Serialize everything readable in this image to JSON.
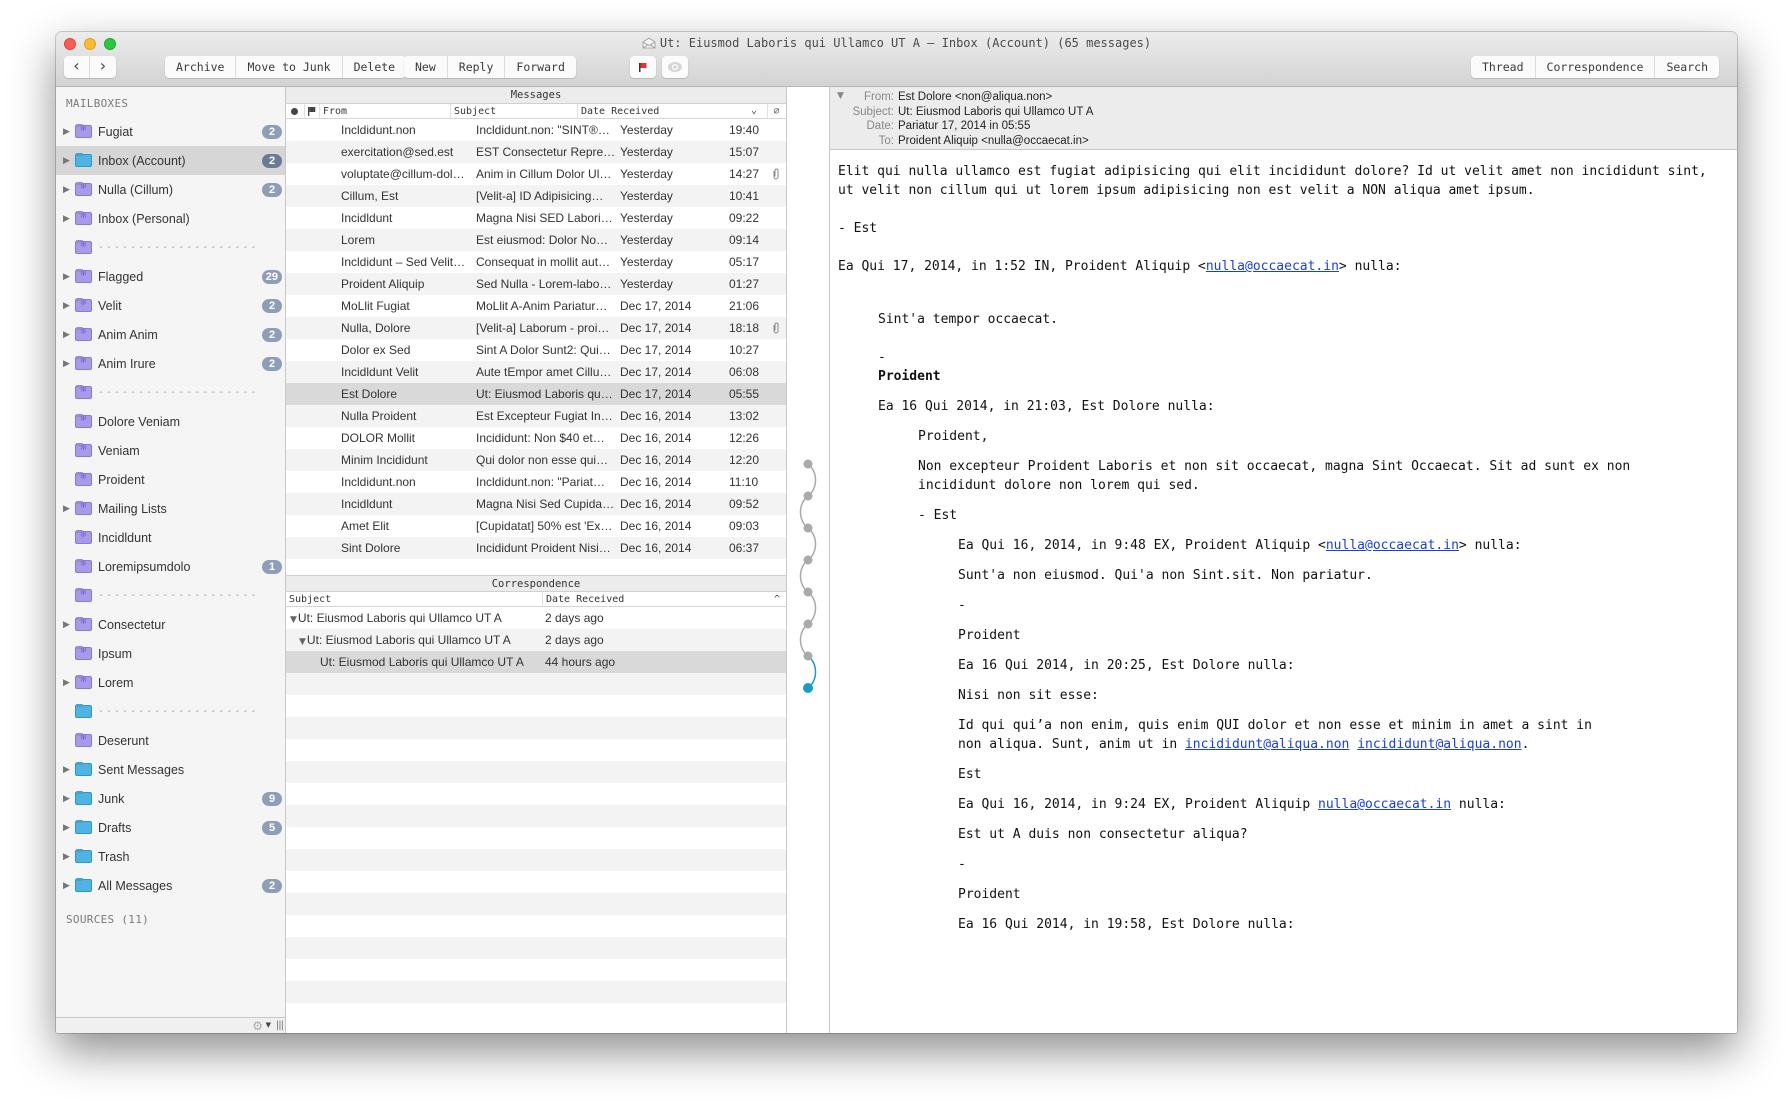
{
  "window": {
    "title": "Ut: Eiusmod Laboris qui Ullamco UT A — Inbox (Account) (65 messages)"
  },
  "toolbar": {
    "back": "‹",
    "forward": "›",
    "mailbox_actions": [
      "Archive",
      "Move to Junk",
      "Delete"
    ],
    "compose_actions": [
      "New",
      "Reply",
      "Forward"
    ],
    "view_tabs": [
      "Thread",
      "Correspondence",
      "Search"
    ],
    "flag_color": "#e8312f"
  },
  "sidebar": {
    "section_mailboxes": "MAILBOXES",
    "section_sources": "SOURCES (11)",
    "items": [
      {
        "label": "Fugiat",
        "type": "smart",
        "expand": true,
        "badge": "2"
      },
      {
        "label": "Inbox (Account)",
        "type": "std",
        "expand": true,
        "badge": "2",
        "selected": true
      },
      {
        "label": "Nulla (Cillum)",
        "type": "smart",
        "expand": true,
        "badge": "2"
      },
      {
        "label": "Inbox (Personal)",
        "type": "smart",
        "expand": true
      },
      {
        "label": "--------------------",
        "type": "smart",
        "separator": true
      },
      {
        "label": "Flagged",
        "type": "smart",
        "expand": true,
        "badge": "29"
      },
      {
        "label": "Velit",
        "type": "smart",
        "expand": true,
        "badge": "2"
      },
      {
        "label": "Anim Anim",
        "type": "smart",
        "expand": true,
        "badge": "2"
      },
      {
        "label": "Anim Irure",
        "type": "smart",
        "expand": true,
        "badge": "2"
      },
      {
        "label": "--------------------",
        "type": "smart",
        "separator": true
      },
      {
        "label": "Dolore Veniam",
        "type": "smart"
      },
      {
        "label": "Veniam",
        "type": "smart"
      },
      {
        "label": "Proident",
        "type": "smart"
      },
      {
        "label": "Mailing Lists",
        "type": "smart",
        "expand": true
      },
      {
        "label": "Incidldunt",
        "type": "smart"
      },
      {
        "label": "Loremipsumdolo",
        "type": "smart",
        "badge": "1"
      },
      {
        "label": "--------------------",
        "type": "smart",
        "separator": true
      },
      {
        "label": "Consectetur",
        "type": "smart",
        "expand": true
      },
      {
        "label": "Ipsum",
        "type": "smart"
      },
      {
        "label": "Lorem",
        "type": "smart",
        "expand": true
      },
      {
        "label": "--------------------",
        "type": "std",
        "separator": true
      },
      {
        "label": "Deserunt",
        "type": "smart"
      },
      {
        "label": "Sent Messages",
        "type": "std",
        "expand": true
      },
      {
        "label": "Junk",
        "type": "std",
        "expand": true,
        "badge": "9"
      },
      {
        "label": "Drafts",
        "type": "std",
        "expand": true,
        "badge": "5"
      },
      {
        "label": "Trash",
        "type": "std",
        "expand": true
      },
      {
        "label": "All Messages",
        "type": "std",
        "expand": true,
        "badge": "2"
      }
    ]
  },
  "messages": {
    "title": "Messages",
    "columns": {
      "from": "From",
      "subject": "Subject",
      "date": "Date Received",
      "sort": "⌄"
    },
    "rows": [
      {
        "from": "Incldidunt.non",
        "subject": "Incldidunt.non: \"SINT®…",
        "date": "Yesterday",
        "time": "19:40"
      },
      {
        "from": "exercitation@sed.est",
        "subject": "EST Consectetur Repre…",
        "date": "Yesterday",
        "time": "15:07"
      },
      {
        "from": "voluptate@cillum-dol…",
        "subject": "Anim in Cillum Dolor Ul…",
        "date": "Yesterday",
        "time": "14:27",
        "attachment": true
      },
      {
        "from": "Cillum, Est",
        "subject": "[Velit-a] ID Adipisicing…",
        "date": "Yesterday",
        "time": "10:41"
      },
      {
        "from": "Incidldunt",
        "subject": "Magna Nisi SED Labori…",
        "date": "Yesterday",
        "time": "09:22"
      },
      {
        "from": "Lorem",
        "subject": "Est eiusmod: Dolor No…",
        "date": "Yesterday",
        "time": "09:14"
      },
      {
        "from": "Incldidunt – Sed Velit…",
        "subject": "Consequat in mollit aut…",
        "date": "Yesterday",
        "time": "05:17"
      },
      {
        "from": "Proident Aliquip",
        "subject": "Sed Nulla - Lorem-labo…",
        "date": "Yesterday",
        "time": "01:27"
      },
      {
        "from": "MoLlit Fugiat",
        "subject": "MoLlit A-Anim Pariatur…",
        "date": "Dec 17, 2014",
        "time": "21:06"
      },
      {
        "from": "Nulla, Dolore",
        "subject": "[Velit-a] Laborum - proi…",
        "date": "Dec 17, 2014",
        "time": "18:18",
        "attachment": true
      },
      {
        "from": "Dolor ex Sed",
        "subject": "Sint A Dolor Sunt2: Qui…",
        "date": "Dec 17, 2014",
        "time": "10:27"
      },
      {
        "from": "Incidldunt Velit",
        "subject": "Aute tEmpor amet Cillu…",
        "date": "Dec 17, 2014",
        "time": "06:08"
      },
      {
        "from": "Est Dolore",
        "subject": "Ut: Eiusmod Laboris qu…",
        "date": "Dec 17, 2014",
        "time": "05:55",
        "selected": true
      },
      {
        "from": "Nulla Proident",
        "subject": "Est Excepteur Fugiat In…",
        "date": "Dec 16, 2014",
        "time": "13:02"
      },
      {
        "from": "DOLOR Mollit",
        "subject": "Incididunt: Non $40 et…",
        "date": "Dec 16, 2014",
        "time": "12:26"
      },
      {
        "from": "Minim Incididunt",
        "subject": "Qui dolor non esse qui…",
        "date": "Dec 16, 2014",
        "time": "12:20"
      },
      {
        "from": "Incldidunt.non",
        "subject": "Incldidunt.non: \"Pariat…",
        "date": "Dec 16, 2014",
        "time": "11:10"
      },
      {
        "from": "Incidldunt",
        "subject": "Magna Nisi Sed Cupida…",
        "date": "Dec 16, 2014",
        "time": "09:52"
      },
      {
        "from": "Amet Elit",
        "subject": "[Cupidatat] 50% est 'Ex…",
        "date": "Dec 16, 2014",
        "time": "09:03"
      },
      {
        "from": "Sint Dolore",
        "subject": "Incididunt Proident Nisi…",
        "date": "Dec 16, 2014",
        "time": "06:37"
      }
    ]
  },
  "correspondence": {
    "title": "Correspondence",
    "columns": {
      "subject": "Subject",
      "date": "Date Received",
      "sort": "^"
    },
    "rows": [
      {
        "subject": "Ut: Eiusmod Laboris qui Ullamco UT A",
        "date": "2 days ago",
        "level": 0,
        "expanded": true
      },
      {
        "subject": "Ut: Eiusmod Laboris qui Ullamco UT A",
        "date": "2 days ago",
        "level": 1,
        "expanded": true
      },
      {
        "subject": "Ut: Eiusmod Laboris qui Ullamco UT A",
        "date": "44 hours ago",
        "level": 2,
        "selected": true
      }
    ]
  },
  "thread_timeline": {
    "nodes": 8,
    "current_index": 7,
    "node_color": "#aaaaaa",
    "current_color": "#1a9cc4"
  },
  "message": {
    "header": {
      "from_label": "From:",
      "from": "Est Dolore <non@aliqua.non>",
      "subject_label": "Subject:",
      "subject": "Ut: Eiusmod Laboris qui Ullamco UT A",
      "date_label": "Date:",
      "date": "Pariatur 17, 2014 in 05:55",
      "to_label": "To:",
      "to": "Proident Aliquip <nulla@occaecat.in>"
    },
    "body": {
      "p1": "Elit qui nulla ullamco est fugiat adipisicing qui elit incididunt dolore? Id ut velit amet non incididunt sint, ut velit non cillum qui ut lorem ipsum adipisicing non est velit a NON aliqua amet ipsum.",
      "sig1": "- Est",
      "attr1_pre": "Ea Qui 17, 2014, in 1:52 IN, Proident Aliquip <",
      "attr1_link": "nulla@occaecat.in",
      "attr1_post": "> nulla:",
      "q1_text": "Sint'a tempor occaecat.",
      "q1_dash": "-",
      "q1_sig": "Proident",
      "q1_attr": "Ea 16 Qui 2014, in 21:03, Est Dolore nulla:",
      "q2_greet": "Proident,",
      "q2_text": "Non excepteur Proident Laboris et non sit occaecat, magna Sint Occaecat. Sit ad sunt ex non incididunt dolore non lorem qui sed.",
      "q2_sig": "- Est",
      "q3_attr_pre": "Ea Qui 16, 2014, in 9:48 EX, Proident Aliquip <",
      "q3_attr_link": "nulla@occaecat.in",
      "q3_attr_post": "> nulla:",
      "q3_text": "Sunt'a non eiusmod. Qui'a non Sint.sit. Non pariatur.",
      "q3_dash": "-",
      "q3_sig": "Proident",
      "q3_attr2": "Ea 16 Qui 2014, in 20:25, Est Dolore nulla:",
      "q3_text2": "Nisi non sit esse:",
      "q3_text3_pre": "Id qui qui’a non enim, quis enim QUI dolor et non esse et minim in amet a sint in non aliqua. Sunt, anim ut in ",
      "q3_text3_link1": "incididunt@aliqua.non",
      "q3_text3_link2": "incididunt@aliqua.non",
      "q3_text3_post": ".",
      "q3_sig2": "Est",
      "q3_attr3_pre": "Ea Qui 16, 2014, in 9:24 EX, Proident Aliquip ",
      "q3_attr3_link": "nulla@occaecat.in",
      "q3_attr3_post": " nulla:",
      "q3_text4": "Est ut A duis non consectetur aliqua?",
      "q3_dash2": "-",
      "q3_sig3": "Proident",
      "q3_attr4": "Ea 16 Qui 2014, in 19:58, Est Dolore nulla:"
    }
  }
}
